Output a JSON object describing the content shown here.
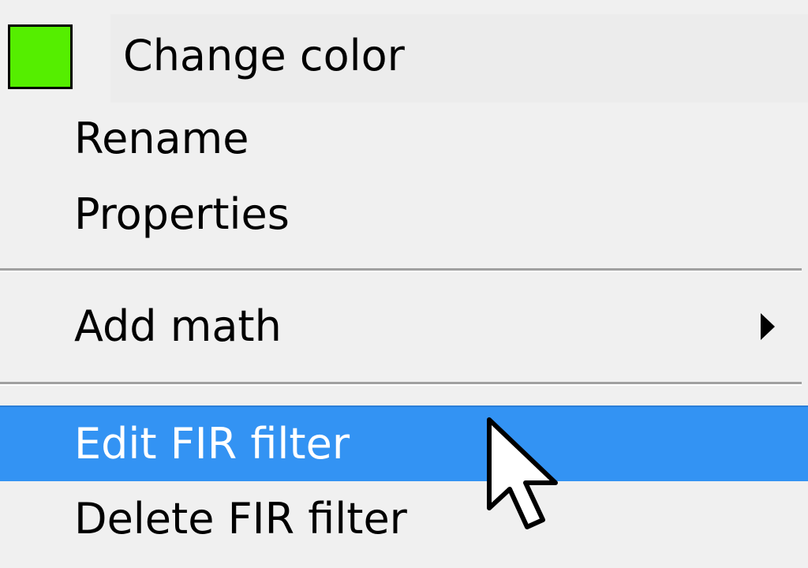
{
  "menu": {
    "change_color": {
      "label": "Change color",
      "swatch_color": "#55ee00"
    },
    "rename": {
      "label": "Rename"
    },
    "properties": {
      "label": "Properties"
    },
    "add_math": {
      "label": "Add math",
      "has_submenu": true,
      "submenu_icon": "chevron-right-icon"
    },
    "edit_fir_filter": {
      "label": "Edit FIR filter",
      "highlighted": true
    },
    "delete_fir_filter": {
      "label": "Delete FIR filter"
    }
  },
  "colors": {
    "highlight": "#3393f3",
    "menu_background": "#f0f0f0",
    "separator": "#a0a0a0"
  },
  "cursor": {
    "icon": "mouse-pointer-icon"
  }
}
